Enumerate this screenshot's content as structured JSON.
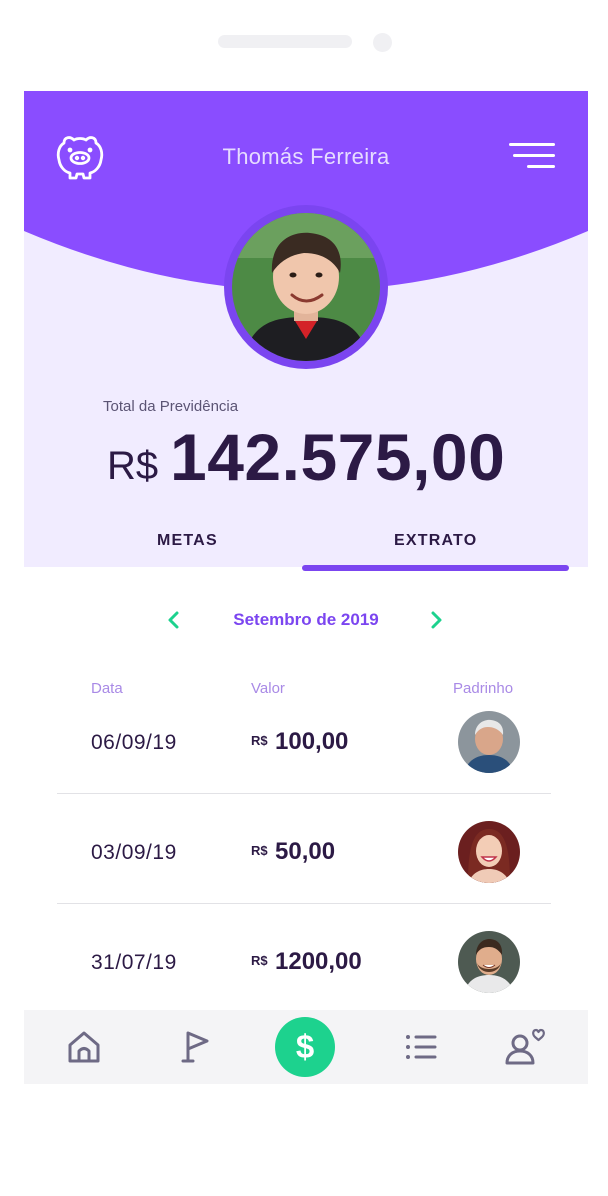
{
  "header": {
    "user_name": "Thomás Ferreira",
    "piggy_icon": "piggy-bank-icon",
    "menu_icon": "hamburger-menu-icon",
    "colors": {
      "purple": "#8a4dff",
      "light": "#f1ecff",
      "text": "#2c1a45"
    }
  },
  "balance": {
    "label": "Total da Previdência",
    "currency": "R$",
    "amount": "142.575,00"
  },
  "tabs": [
    {
      "label": "METAS",
      "active": false
    },
    {
      "label": "EXTRATO",
      "active": true
    }
  ],
  "month": {
    "label": "Setembro de 2019",
    "prev_icon": "chevron-left-icon",
    "next_icon": "chevron-right-icon",
    "accent": "#1dd28e"
  },
  "table": {
    "headers": {
      "date": "Data",
      "value": "Valor",
      "sponsor": "Padrinho"
    },
    "rows": [
      {
        "date": "06/09/19",
        "currency": "R$",
        "value": "100,00",
        "sponsor_avatar": "elderly-man-avatar"
      },
      {
        "date": "03/09/19",
        "currency": "R$",
        "value": "50,00",
        "sponsor_avatar": "woman-avatar"
      },
      {
        "date": "31/07/19",
        "currency": "R$",
        "value": "1200,00",
        "sponsor_avatar": "bearded-man-avatar"
      }
    ]
  },
  "bottom_nav": {
    "items": [
      "home-icon",
      "flag-icon",
      "dollar-icon",
      "list-icon",
      "user-heart-icon"
    ],
    "money_symbol": "$",
    "active": "dollar-icon"
  }
}
